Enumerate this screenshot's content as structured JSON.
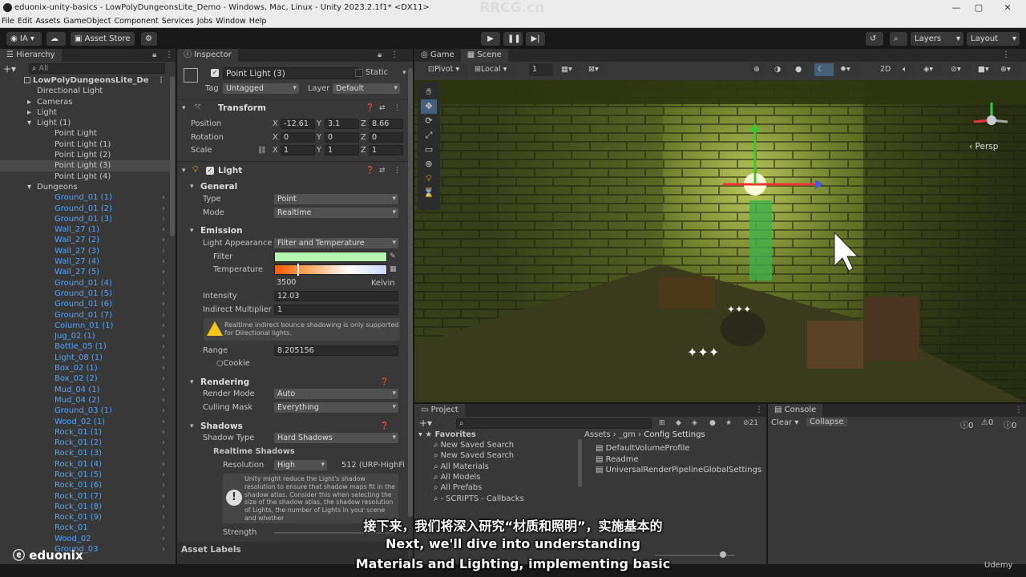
{
  "window": {
    "title": "eduonix-unity-basics - LowPolyDungeonsLite_Demo - Windows, Mac, Linux - Unity 2023.2.1f1* <DX11>",
    "watermark": "RRCG.cn"
  },
  "menu": [
    "File",
    "Edit",
    "Assets",
    "GameObject",
    "Component",
    "Services",
    "Jobs",
    "Window",
    "Help"
  ],
  "toolbar": {
    "account": "IA",
    "asset_store": "Asset Store",
    "layers": "Layers",
    "layout": "Layout"
  },
  "hierarchy": {
    "tab": "Hierarchy",
    "search_placeholder": "All",
    "scene": "LowPolyDungeonsLite_De",
    "items": [
      "Directional Light",
      "Cameras",
      "Light",
      "Light (1)",
      "Point Light",
      "Point Light (1)",
      "Point Light (2)",
      "Point Light (3)",
      "Point Light (4)",
      "Dungeons",
      "Ground_01 (1)",
      "Ground_01 (2)",
      "Ground_01 (3)",
      "Wall_27 (1)",
      "Wall_27 (2)",
      "Wall_27 (3)",
      "Wall_27 (4)",
      "Wall_27 (5)",
      "Ground_01 (4)",
      "Ground_01 (5)",
      "Ground_01 (6)",
      "Ground_01 (7)",
      "Column_01 (1)",
      "Jug_02 (1)",
      "Bottle_05 (1)",
      "Light_08 (1)",
      "Box_02 (1)",
      "Box_02 (2)",
      "Mud_04 (1)",
      "Mud_04 (2)",
      "Ground_03 (1)",
      "Wood_02 (1)",
      "Rock_01 (1)",
      "Rock_01 (2)",
      "Rock_01 (3)",
      "Rock_01 (4)",
      "Rock_01 (5)",
      "Rock_01 (6)",
      "Rock_01 (7)",
      "Rock_01 (8)",
      "Rock_01 (9)",
      "Rock_01",
      "Wood_02",
      "Ground_03"
    ]
  },
  "inspector": {
    "tab": "Inspector",
    "object_name": "Point Light (3)",
    "static": "Static",
    "tag_label": "Tag",
    "tag": "Untagged",
    "layer_label": "Layer",
    "layer": "Default",
    "transform": {
      "title": "Transform",
      "position": "Position",
      "rotation": "Rotation",
      "scale": "Scale",
      "pos": [
        "-12.61",
        "3.1",
        "8.66"
      ],
      "rot": [
        "0",
        "0",
        "0"
      ],
      "scl": [
        "1",
        "1",
        "1"
      ]
    },
    "light": {
      "title": "Light",
      "general": "General",
      "type_label": "Type",
      "type": "Point",
      "mode_label": "Mode",
      "mode": "Realtime",
      "emission": "Emission",
      "appearance_label": "Light Appearance",
      "appearance": "Filter and Temperature",
      "filter_label": "Filter",
      "temperature_label": "Temperature",
      "temperature": "3500",
      "kelvin": "Kelvin",
      "intensity_label": "Intensity",
      "intensity": "12.03",
      "indirect_label": "Indirect Multiplier",
      "indirect": "1",
      "warning": "Realtime indirect bounce shadowing is only supported for Directional lights.",
      "range_label": "Range",
      "range": "8.205156",
      "cookie": "Cookie",
      "rendering": "Rendering",
      "render_mode_label": "Render Mode",
      "render_mode": "Auto",
      "culling_label": "Culling Mask",
      "culling": "Everything",
      "shadows": "Shadows",
      "shadow_type_label": "Shadow Type",
      "shadow_type": "Hard Shadows",
      "realtime_shadows": "Realtime Shadows",
      "resolution_label": "Resolution",
      "resolution": "High",
      "resolution_note": "512 (URP-HighFi",
      "shadow_info": "Unity might reduce the Light's shadow resolution to ensure that shadow maps fit in the shadow atlas. Consider this when selecting the size of the shadow atlas, the shadow resolution of Lights, the number of Lights in your scene and whether",
      "strength_label": "Strength"
    },
    "asset_labels": "Asset Labels"
  },
  "game_tab": "Game",
  "scene_tab": "Scene",
  "pivot": "Pivot",
  "local": "Local",
  "grid_num": "1",
  "twod": "2D",
  "persp": "Persp",
  "project": {
    "tab": "Project",
    "favorites": "Favorites",
    "fav_items": [
      "New Saved Search",
      "New Saved Search",
      "All Materials",
      "All Models",
      "All Prefabs",
      "- SCRIPTS - Callbacks"
    ],
    "breadcrumb": [
      "Assets",
      "_gm",
      "Config Settings"
    ],
    "files": [
      "DefaultVolumeProfile",
      "Readme",
      "UniversalRenderPipelineGlobalSettings"
    ],
    "hidden_count": "21"
  },
  "console": {
    "tab": "Console",
    "clear": "Clear",
    "collapse": "Collapse",
    "counts": [
      "0",
      "0",
      "0"
    ]
  },
  "subtitles": {
    "cn": "接下来，我们将深入研究“材质和照明”，实施基本的",
    "en1": "Next, we'll dive into understanding",
    "en2": "Materials and Lighting, implementing basic"
  },
  "brand": "eduonix",
  "udemy": "Udemy",
  "colors": {
    "accent": "#4fa6ff",
    "filter": "#b4f5b0",
    "temperature_start": "#ff6a00",
    "temperature_end": "#c8d8ff"
  }
}
